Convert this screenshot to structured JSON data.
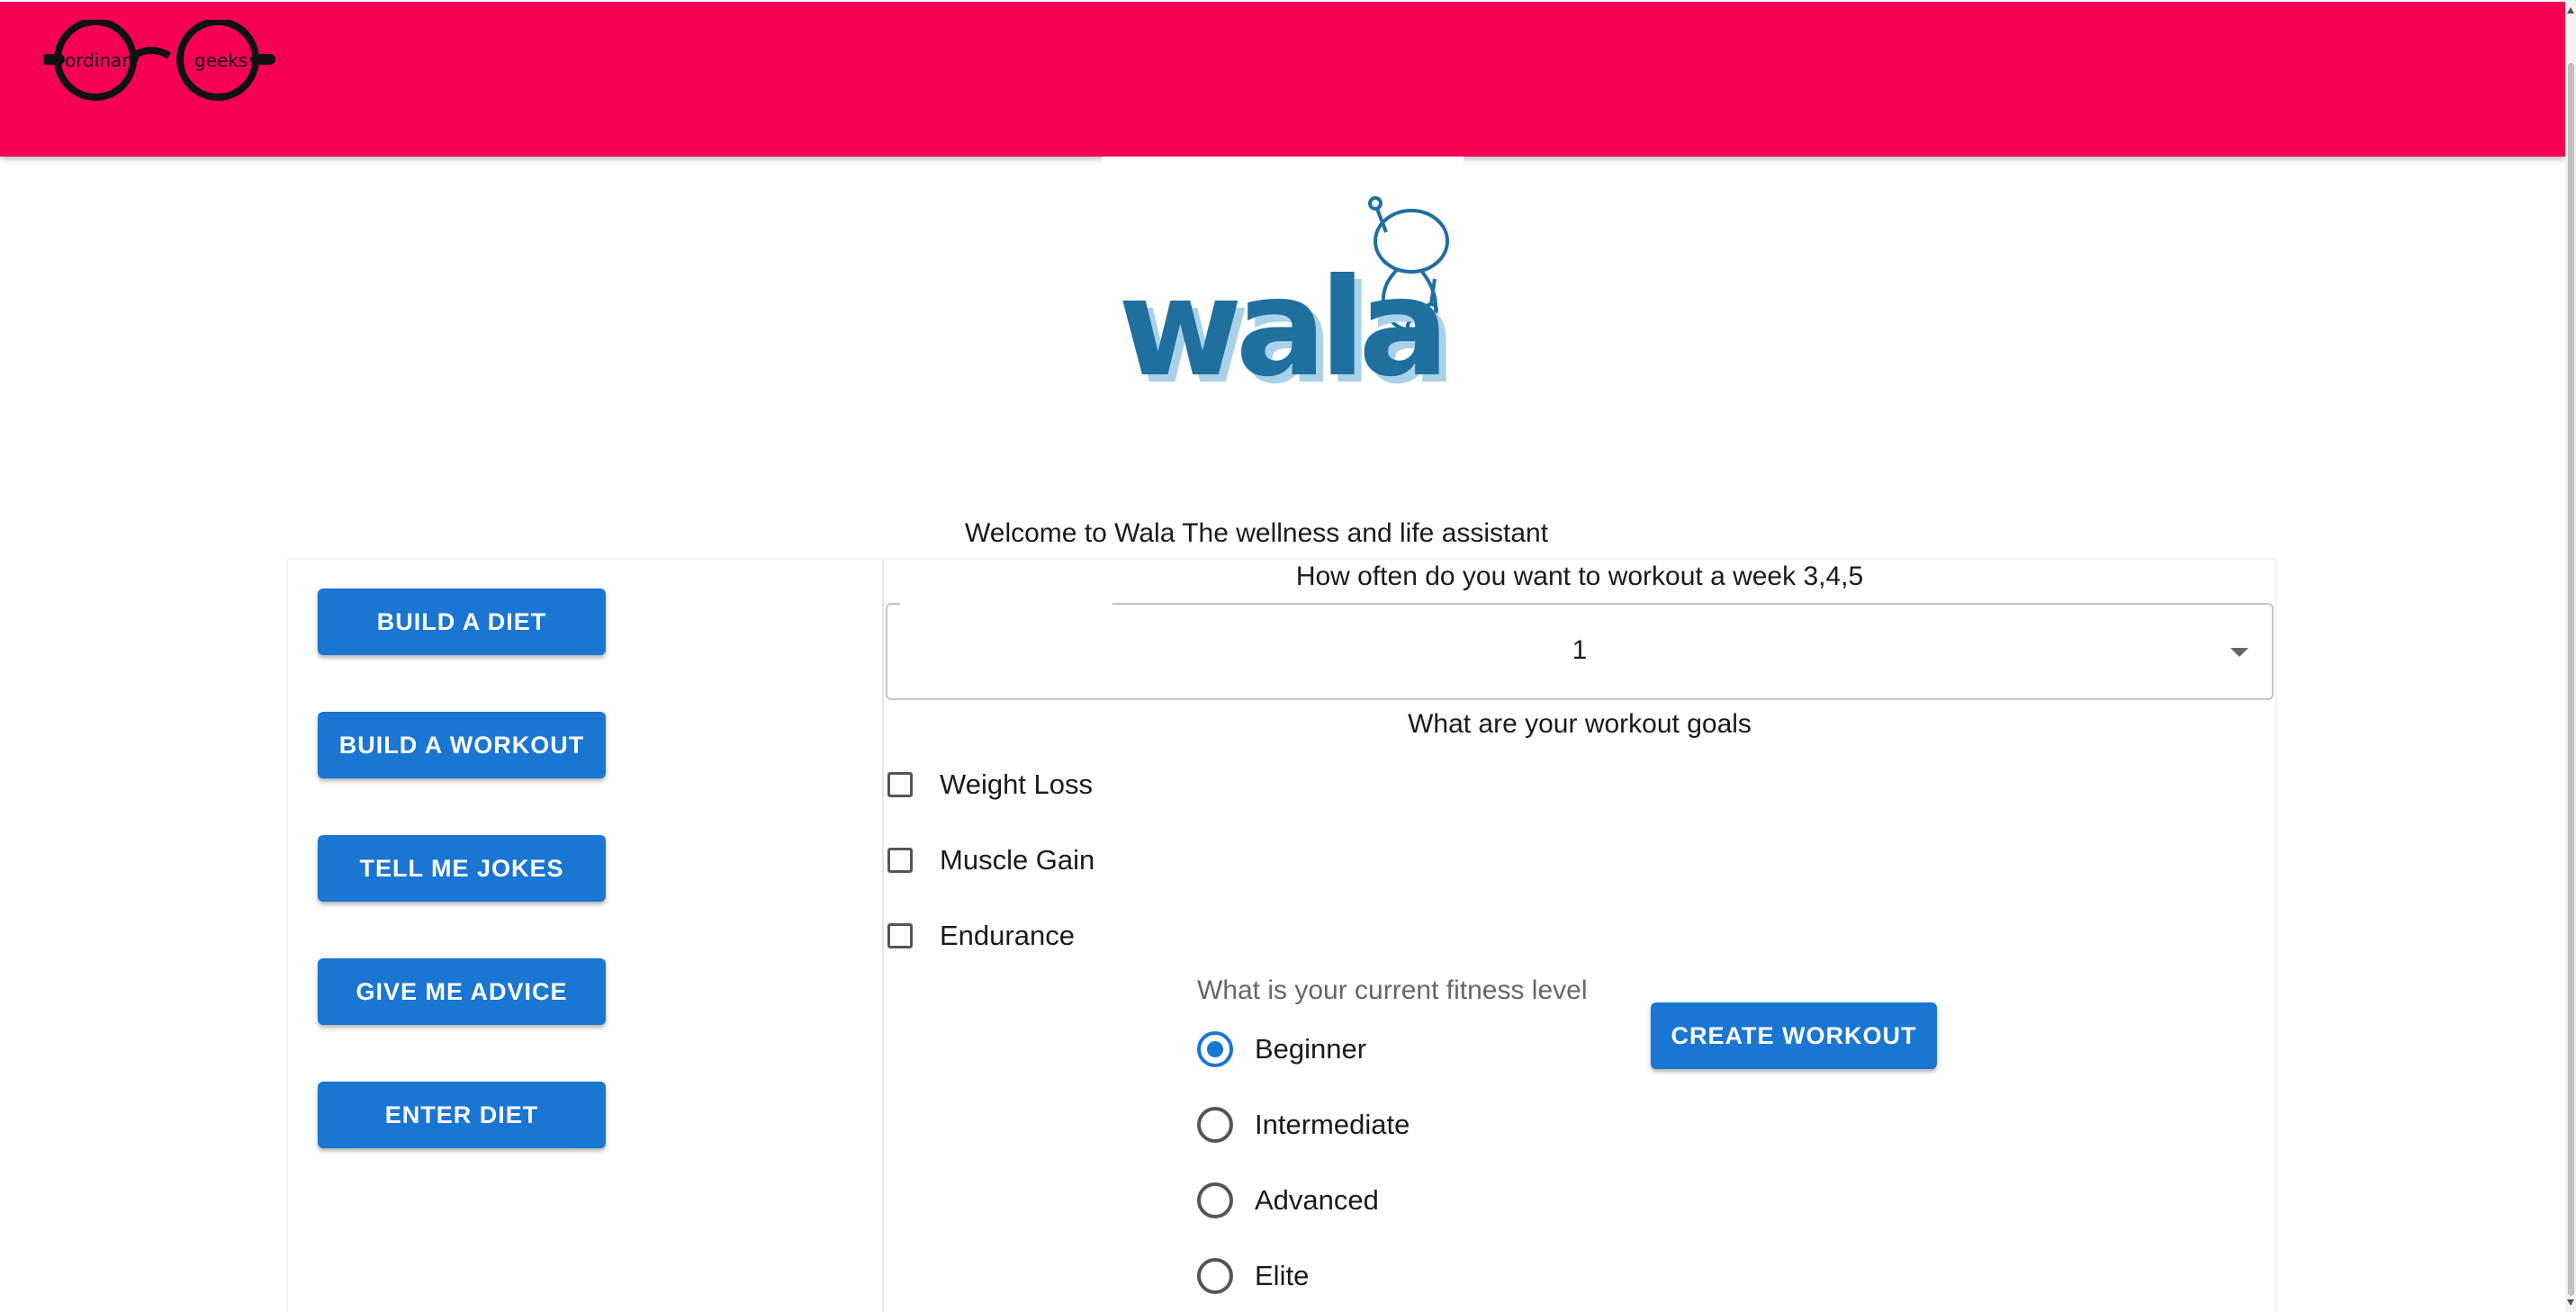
{
  "header": {
    "logo": {
      "name": "ordinary-geeks-glasses-icon",
      "text_left": "ordinary",
      "text_right": "geeks"
    },
    "color": "#f50057"
  },
  "brand": {
    "logo_text": "wala",
    "logo_color": "#1f6f9f"
  },
  "welcome_text": "Welcome to Wala The wellness and life assistant",
  "sidebar": {
    "buttons": [
      {
        "label": "BUILD A DIET"
      },
      {
        "label": "BUILD A WORKOUT"
      },
      {
        "label": "TELL ME JOKES"
      },
      {
        "label": "GIVE ME ADVICE"
      },
      {
        "label": "ENTER DIET"
      }
    ],
    "button_color": "#1976d2"
  },
  "workout_form": {
    "frequency_label": "How often do you want to workout a week 3,4,5",
    "frequency_value": "1",
    "goals_label": "What are your workout goals",
    "goals": [
      {
        "label": "Weight Loss",
        "checked": false
      },
      {
        "label": "Muscle Gain",
        "checked": false
      },
      {
        "label": "Endurance",
        "checked": false
      }
    ],
    "fitness_label": "What is your current fitness level",
    "fitness_levels": [
      {
        "label": "Beginner",
        "selected": true
      },
      {
        "label": "Intermediate",
        "selected": false
      },
      {
        "label": "Advanced",
        "selected": false
      },
      {
        "label": "Elite",
        "selected": false
      }
    ],
    "create_button_label": "CREATE WORKOUT"
  }
}
